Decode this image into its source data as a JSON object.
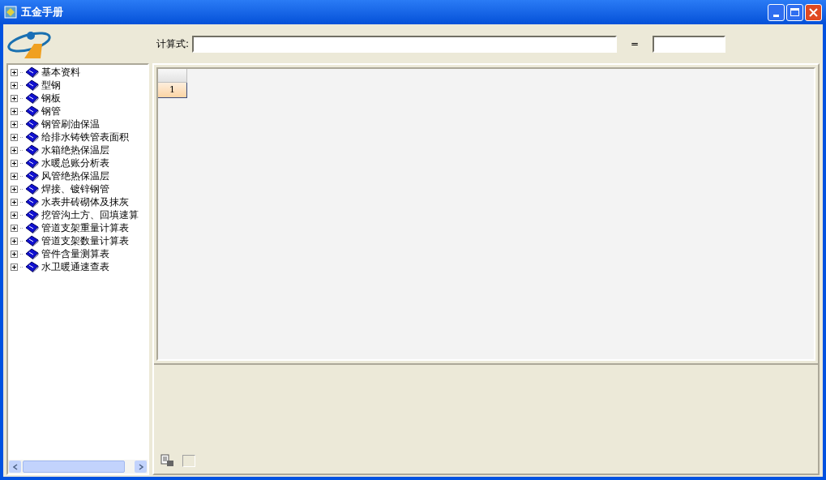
{
  "window": {
    "title": "五金手册"
  },
  "formula": {
    "label": "计算式:",
    "equals": "="
  },
  "tree": {
    "items": [
      {
        "label": "基本资料",
        "expanded": false
      },
      {
        "label": "型钢",
        "expanded": false
      },
      {
        "label": "钢板",
        "expanded": false
      },
      {
        "label": "钢管",
        "expanded": false
      },
      {
        "label": "钢管刷油保温",
        "expanded": false
      },
      {
        "label": "给排水铸铁管表面积",
        "expanded": false
      },
      {
        "label": "水箱绝热保温层",
        "expanded": false
      },
      {
        "label": "水暖总账分析表",
        "expanded": false
      },
      {
        "label": "风管绝热保温层",
        "expanded": false
      },
      {
        "label": "焊接、镀锌钢管",
        "expanded": false
      },
      {
        "label": "水表井砖砌体及抹灰",
        "expanded": false
      },
      {
        "label": "挖管沟土方、回填速算",
        "expanded": false
      },
      {
        "label": "管道支架重量计算表",
        "expanded": false
      },
      {
        "label": "管道支架数量计算表",
        "expanded": false
      },
      {
        "label": "管件含量测算表",
        "expanded": false
      },
      {
        "label": "水卫暖通速查表",
        "expanded": false
      }
    ]
  },
  "grid": {
    "rows": [
      {
        "header": "1",
        "selected": true
      }
    ]
  },
  "footer": {
    "checkbox": {
      "checked": false
    }
  }
}
